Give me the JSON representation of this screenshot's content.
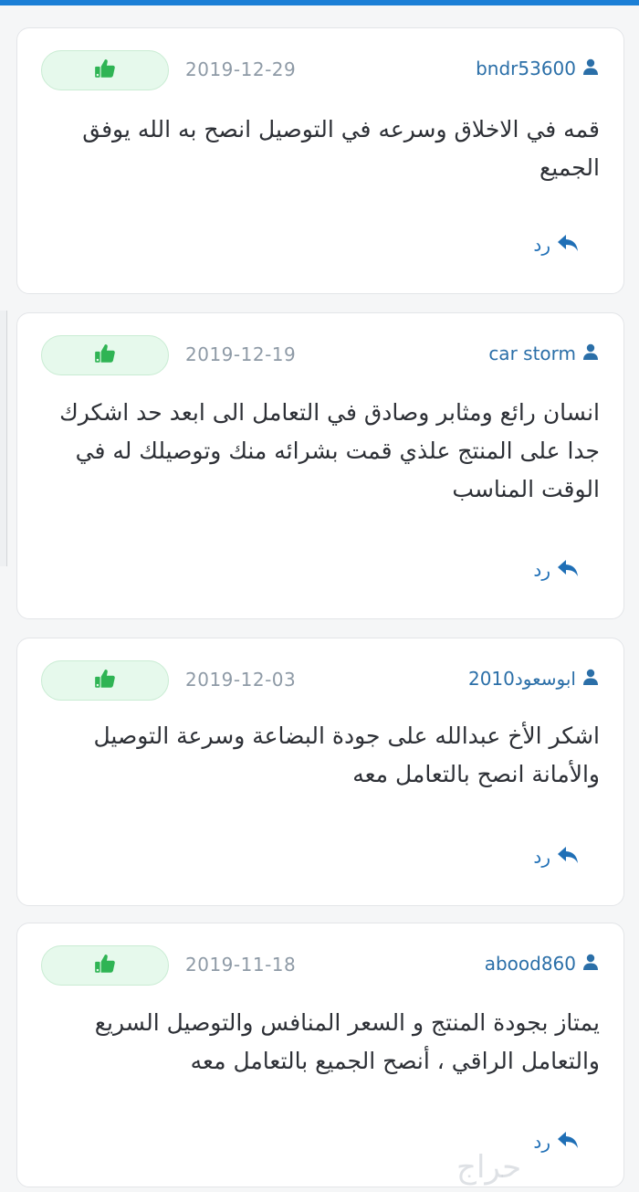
{
  "colors": {
    "accent": "#1b7fd6",
    "username": "#2b6fa8",
    "date": "#8e9aa6",
    "like_green": "#2fb454",
    "reply_blue": "#1f6fb6"
  },
  "reviews": [
    {
      "username": "bndr53600",
      "date": "2019-12-29",
      "text": "قمه في الاخلاق وسرعه في التوصيل انصح به الله يوفق الجميع",
      "reply_label": "رد",
      "like_icon": "thumbs-up-icon",
      "user_icon": "user-icon",
      "reply_icon": "reply-arrow-icon"
    },
    {
      "username": "car storm",
      "date": "2019-12-19",
      "text": "انسان رائع ومثابر وصادق في التعامل الى ابعد حد اشكرك جدا على المنتج علذي قمت بشرائه منك وتوصيلك له في الوقت المناسب",
      "reply_label": "رد",
      "like_icon": "thumbs-up-icon",
      "user_icon": "user-icon",
      "reply_icon": "reply-arrow-icon"
    },
    {
      "username": "ابوسعود2010",
      "date": "2019-12-03",
      "text": "اشكر الأخ عبدالله على جودة البضاعة وسرعة التوصيل والأمانة انصح بالتعامل معه",
      "reply_label": "رد",
      "like_icon": "thumbs-up-icon",
      "user_icon": "user-icon",
      "reply_icon": "reply-arrow-icon"
    },
    {
      "username": "abood860",
      "date": "2019-11-18",
      "text": "يمتاز بجودة المنتج و السعر المنافس والتوصيل السريع والتعامل الراقي ، أنصح الجميع بالتعامل معه",
      "reply_label": "رد",
      "like_icon": "thumbs-up-icon",
      "user_icon": "user-icon",
      "reply_icon": "reply-arrow-icon"
    }
  ],
  "watermark": "حراج"
}
